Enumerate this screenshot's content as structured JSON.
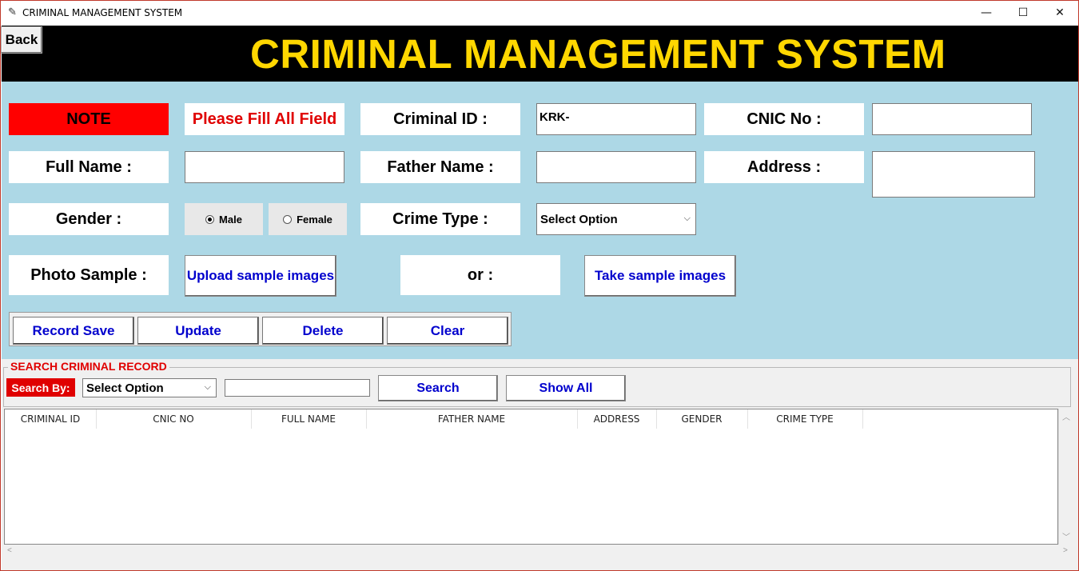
{
  "window": {
    "title": "CRIMINAL MANAGEMENT SYSTEM",
    "minimize": "—",
    "maximize": "☐",
    "close": "✕"
  },
  "header": {
    "title": "CRIMINAL MANAGEMENT SYSTEM",
    "back_label": "Back"
  },
  "form": {
    "note_label": "NOTE",
    "note_text": "Please Fill All Field",
    "criminal_id_label": "Criminal ID :",
    "criminal_id_value": "KRK-",
    "cnic_label": "CNIC No :",
    "cnic_value": "",
    "full_name_label": "Full Name :",
    "full_name_value": "",
    "father_name_label": "Father Name :",
    "father_name_value": "",
    "address_label": "Address :",
    "address_value": "",
    "gender_label": "Gender :",
    "gender_options": [
      "Male",
      "Female"
    ],
    "gender_selected": "Male",
    "crime_type_label": "Crime Type :",
    "crime_type_value": "Select Option",
    "photo_label": "Photo Sample :",
    "upload_label": "Upload sample images",
    "or_label": "or :",
    "take_label": "Take sample images"
  },
  "actions": {
    "save": "Record Save",
    "update": "Update",
    "delete": "Delete",
    "clear": "Clear"
  },
  "search": {
    "title": "SEARCH CRIMINAL RECORD",
    "by_label": "Search By:",
    "select_value": "Select Option",
    "input_value": "",
    "search_label": "Search",
    "show_all_label": "Show All"
  },
  "table": {
    "columns": [
      "CRIMINAL ID",
      "CNIC NO",
      "FULL NAME",
      "FATHER NAME",
      "ADDRESS",
      "GENDER",
      "CRIME TYPE"
    ],
    "rows": []
  },
  "colors": {
    "header_bg": "#000000",
    "header_text": "#FFD700",
    "form_bg": "#ADD8E6",
    "note_bg": "#FF0000",
    "note_text": "#E00000",
    "button_text": "#0000CD"
  }
}
